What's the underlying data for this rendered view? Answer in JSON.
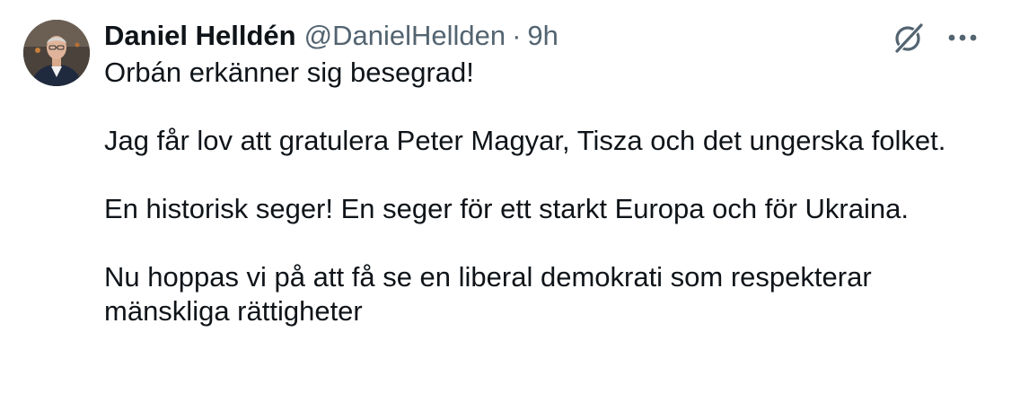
{
  "author": {
    "display_name": "Daniel Helldén",
    "handle": "@DanielHellden",
    "separator": "·",
    "timestamp": "9h"
  },
  "icons": {
    "grok": "grok-icon",
    "more": "more-options-icon",
    "avatar": "profile-avatar"
  },
  "colors": {
    "text_primary": "#0f1419",
    "text_secondary": "#536471",
    "background": "#ffffff"
  },
  "tweet": {
    "paragraphs": [
      "Orbán erkänner sig besegrad!",
      "Jag får lov att gratulera Peter Magyar, Tisza och det ungerska folket.",
      "En historisk seger! En seger för ett starkt Europa och för Ukraina.",
      "Nu hoppas vi på att få se en liberal demokrati som respekterar mänskliga rättigheter"
    ]
  }
}
